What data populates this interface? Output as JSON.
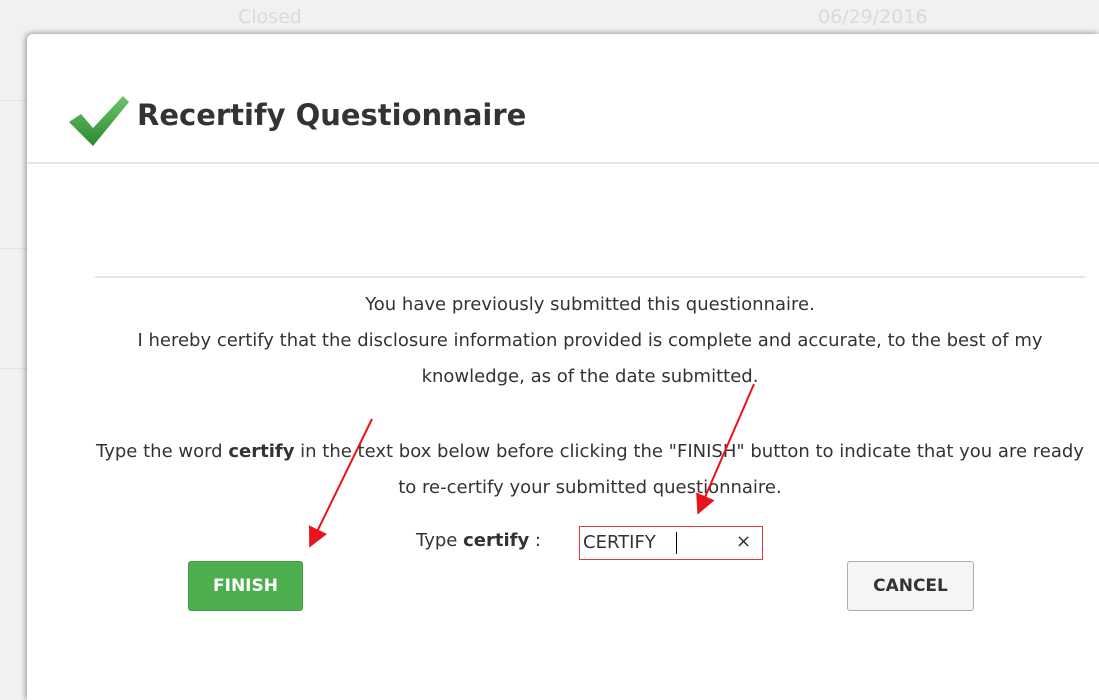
{
  "background": {
    "row_status": "Closed",
    "row_date": "06/29/2016"
  },
  "modal": {
    "title": "Recertify Questionnaire",
    "icon": "checkmark-icon",
    "lines": [
      "You have previously submitted this questionnaire.",
      "I hereby certify that the disclosure information provided is complete and accurate, to the best of my knowledge, as of the date submitted."
    ],
    "instruction_prefix": "Type the word ",
    "instruction_keyword": "certify",
    "instruction_suffix": " in the text box below before clicking the \"FINISH\" button to indicate that you are ready to re-certify your submitted questionnaire.",
    "certify_label_prefix": "Type ",
    "certify_label_keyword": "certify",
    "certify_label_suffix": " :",
    "certify_input_value": "CERTIFY",
    "clear_symbol": "×",
    "finish_label": "FINISH",
    "cancel_label": "CANCEL"
  },
  "colors": {
    "finish": "#4cae4c",
    "highlight_border": "#e23b3b",
    "annotation_arrow": "#e8141b",
    "check": "#3a9b3a"
  }
}
